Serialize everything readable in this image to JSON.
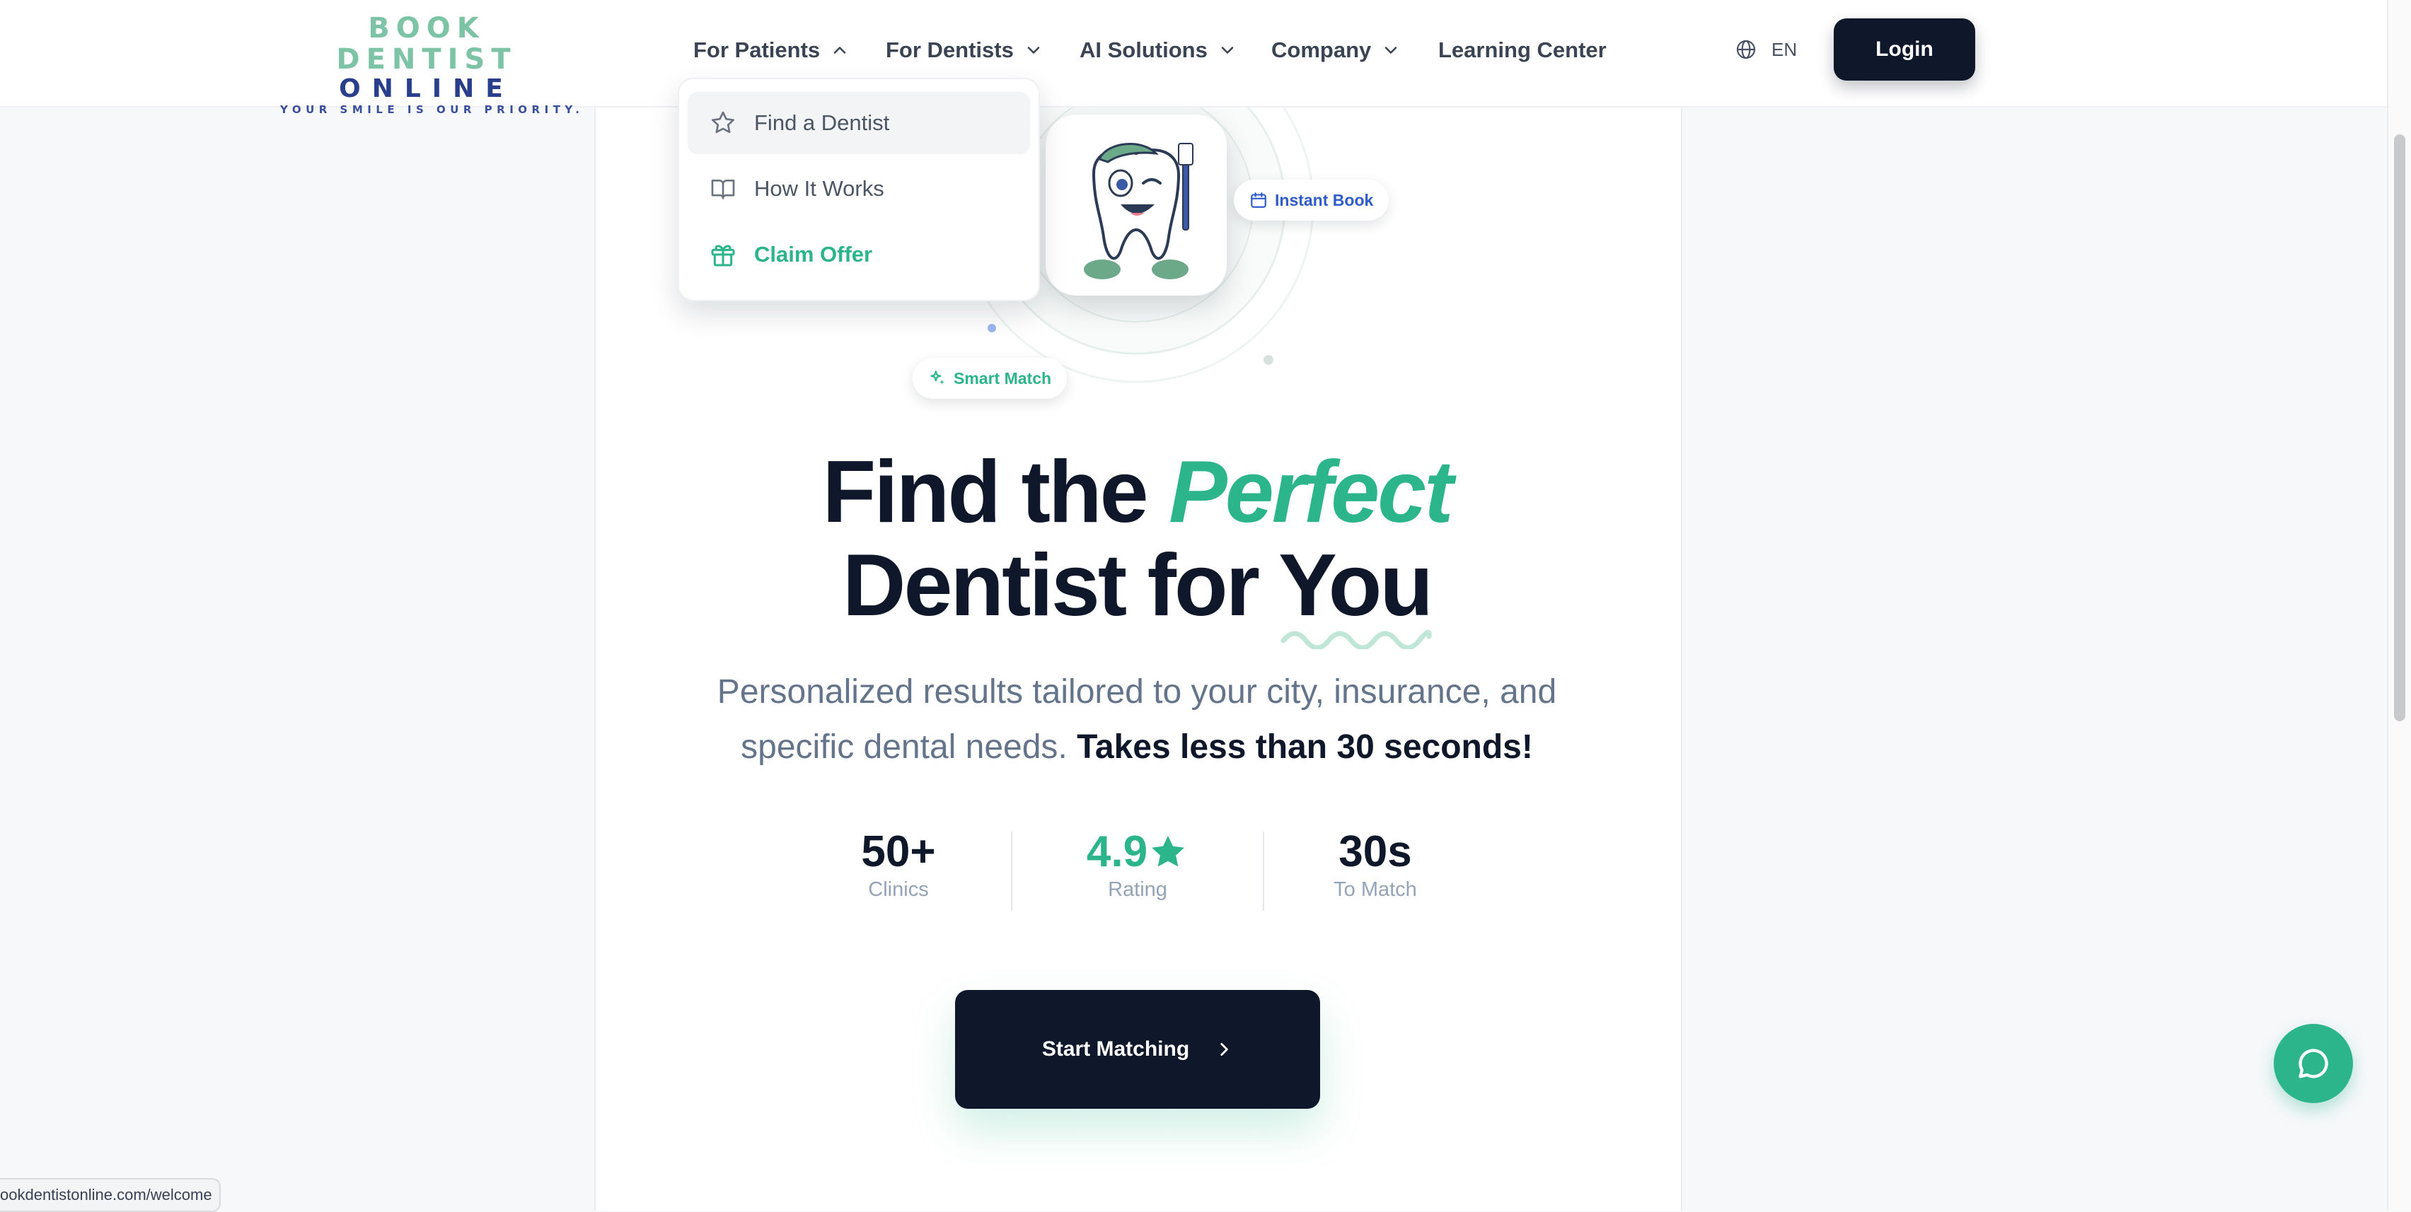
{
  "logo": {
    "line1": "BOOK DENTIST",
    "line2": "ONLINE",
    "tagline": "YOUR SMILE IS OUR PRIORITY."
  },
  "nav": {
    "items": [
      {
        "label": "For Patients"
      },
      {
        "label": "For Dentists"
      },
      {
        "label": "AI Solutions"
      },
      {
        "label": "Company"
      },
      {
        "label": "Learning Center"
      }
    ],
    "lang": "EN",
    "login": "Login"
  },
  "dropdown": {
    "items": [
      {
        "label": "Find a Dentist",
        "icon": "star-icon"
      },
      {
        "label": "How It Works",
        "icon": "book-icon"
      },
      {
        "label": "Claim Offer",
        "icon": "gift-icon"
      }
    ]
  },
  "badges": {
    "instant": "Instant Book",
    "smart": "Smart Match"
  },
  "hero": {
    "line1_a": "Find the ",
    "line1_b": "Perfect",
    "line2_a": "Dentist for ",
    "line2_b": "You",
    "subtitle": "Personalized results tailored to your city, insurance, and specific dental needs. ",
    "subtitle_bold": "Takes less than 30 seconds!"
  },
  "stats": [
    {
      "value": "50+",
      "label": "Clinics"
    },
    {
      "value": "4.9",
      "label": "Rating"
    },
    {
      "value": "30s",
      "label": "To Match"
    }
  ],
  "cta": {
    "label": "Start Matching"
  },
  "status_url": "ookdentistonline.com/welcome",
  "colors": {
    "brand_green": "#2cb58b",
    "navy": "#0f172a",
    "link_blue": "#2f5cc8"
  }
}
